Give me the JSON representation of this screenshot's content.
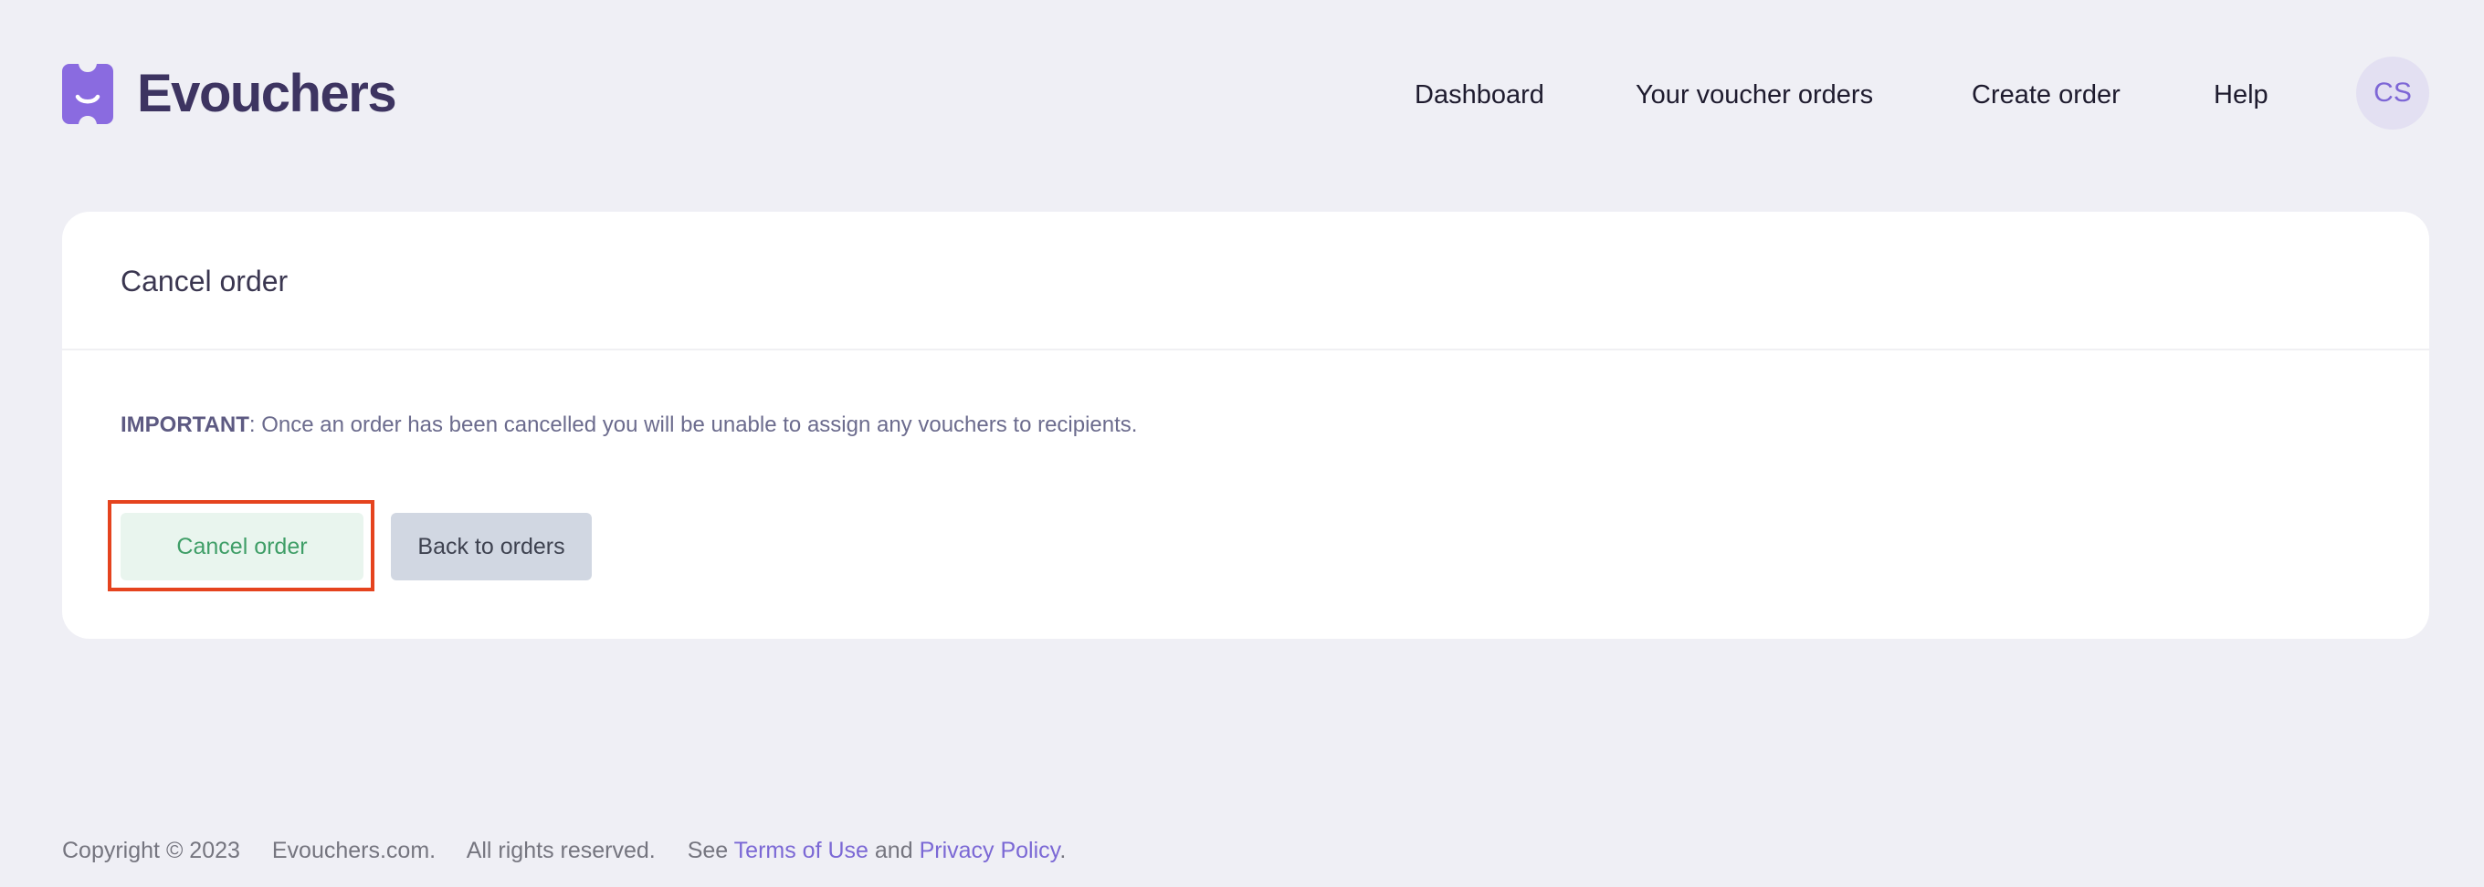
{
  "brand": {
    "name": "Evouchers",
    "accent_color": "#8a6be0",
    "logo_icon": "ticket-smile-logo-icon"
  },
  "nav": {
    "dashboard": "Dashboard",
    "voucher_orders": "Your voucher orders",
    "create_order": "Create order",
    "help": "Help",
    "avatar_initials": "CS"
  },
  "card": {
    "title": "Cancel order",
    "notice_label": "IMPORTANT",
    "notice_text": ": Once an order has been cancelled you will be unable to assign any vouchers to recipients.",
    "cancel_button": "Cancel order",
    "back_button": "Back to orders"
  },
  "footer": {
    "copyright": "Copyright © 2023",
    "domain": "Evouchers.com.",
    "rights": "All rights reserved.",
    "see": "See",
    "terms": "Terms of Use",
    "and": "and",
    "privacy": "Privacy Policy",
    "period": "."
  },
  "colors": {
    "highlight_border": "#e5431e",
    "cancel_text": "#3f9e67",
    "cancel_bg": "#e9f5ee",
    "back_bg": "#d1d7e2"
  }
}
